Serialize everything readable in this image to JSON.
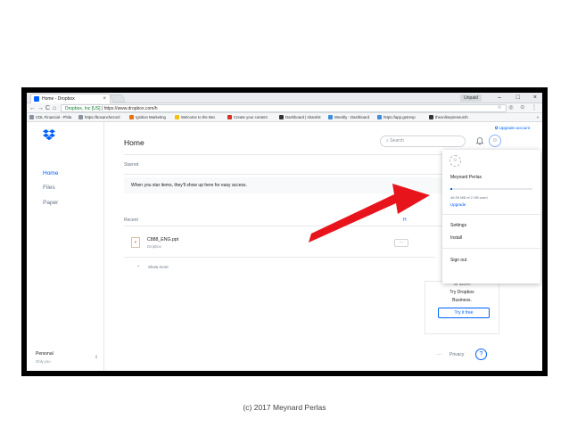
{
  "browser": {
    "tab_title": "Home - Dropbox",
    "tab_close": "×",
    "window_user": "Unpaid",
    "controls": [
      "–",
      "□",
      "×"
    ],
    "nav_icons": [
      "←",
      "→",
      "C",
      "⌂"
    ],
    "url_secure": "Dropbox, Inc [US]",
    "url": "https://www.dropbox.com/h",
    "url_icons": "☆ ◎ ⊙ ⋮",
    "bookmarks": [
      {
        "label": "CDL Financial - Phila",
        "color": "#8a939c"
      },
      {
        "label": "https://bosanchezonl",
        "color": "#8a939c"
      },
      {
        "label": "Ignition Marketing",
        "color": "#e8710a"
      },
      {
        "label": "Welcome to the Bec",
        "color": "#f4c20d"
      },
      {
        "label": "Create your content",
        "color": "#d93025"
      },
      {
        "label": "Dashboard | sharelst",
        "color": "#333333"
      },
      {
        "label": "Weebly - Dashboard",
        "color": "#3c8dde"
      },
      {
        "label": "https://app.getresp",
        "color": "#3c8dde"
      },
      {
        "label": "theonlinepreneursh",
        "color": "#333333"
      }
    ],
    "bookmarks_more": "»"
  },
  "sidebar": {
    "items": [
      {
        "label": "Home",
        "active": true
      },
      {
        "label": "Files",
        "active": false
      },
      {
        "label": "Paper",
        "active": false
      }
    ],
    "account_type": "Personal",
    "account_sub": "Only you",
    "caret": "⇕"
  },
  "main": {
    "upgrade_account": "Upgrade account",
    "title": "Home",
    "search_placeholder": "Search",
    "bell_icon": "🔔",
    "avatar_glyph": "☺",
    "starred_heading": "Starred",
    "starred_empty": "When you star items, they'll show up here for easy access.",
    "recent_heading": "Recent",
    "recent_right": "H",
    "files": [
      {
        "name": "C888_ENG.ppt",
        "location": "Dropbox",
        "ext": "P"
      }
    ],
    "more_glyph": "···",
    "show_more_caret": "⌄",
    "show_more": "Show more",
    "promo_partial": "for $20/m",
    "promo_line1": "Try Dropbox",
    "promo_line2": "Business.",
    "promo_button": "Try it free",
    "footer_dots": "···",
    "privacy": "Privacy",
    "help": "?"
  },
  "account_menu": {
    "avatar_glyph": "☺",
    "name": "Meynard Perlas",
    "usage_fraction": 0.02,
    "usage_text": "46.99 MB of 2 GB used",
    "upgrade": "Upgrade",
    "settings": "Settings",
    "install": "Install",
    "sign_out": "Sign out"
  },
  "annotation_arrow_color": "#e8141c",
  "caption": "(c) 2017 Meynard Perlas"
}
